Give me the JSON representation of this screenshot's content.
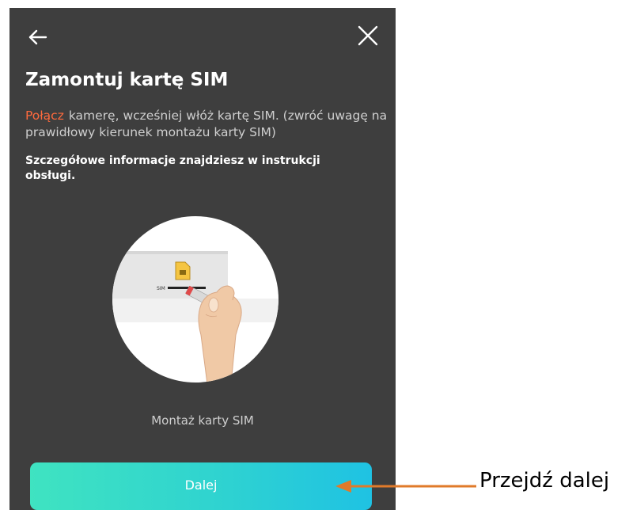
{
  "header": {
    "back_icon": "arrow-left-icon",
    "close_icon": "close-icon"
  },
  "title": "Zamontuj kartę SIM",
  "description": {
    "link": "Połącz",
    "text": "kamerę, wcześniej włóż kartę SIM. (zwróć uwagę na prawidłowy kierunek montażu karty SIM)"
  },
  "info": "Szczegółowe informacje znajdziesz w instrukcji obsługi.",
  "illustration": {
    "sim_label": "SIM"
  },
  "caption": "Montaż karty SIM",
  "next_button": "Dalej",
  "annotation": {
    "label": "Przejdź dalej",
    "arrow_color": "#e07a2a"
  },
  "colors": {
    "background": "#3e3e3e",
    "link": "#ff6a3d",
    "button_start": "#3fe3c1",
    "button_end": "#1fc2e3"
  }
}
